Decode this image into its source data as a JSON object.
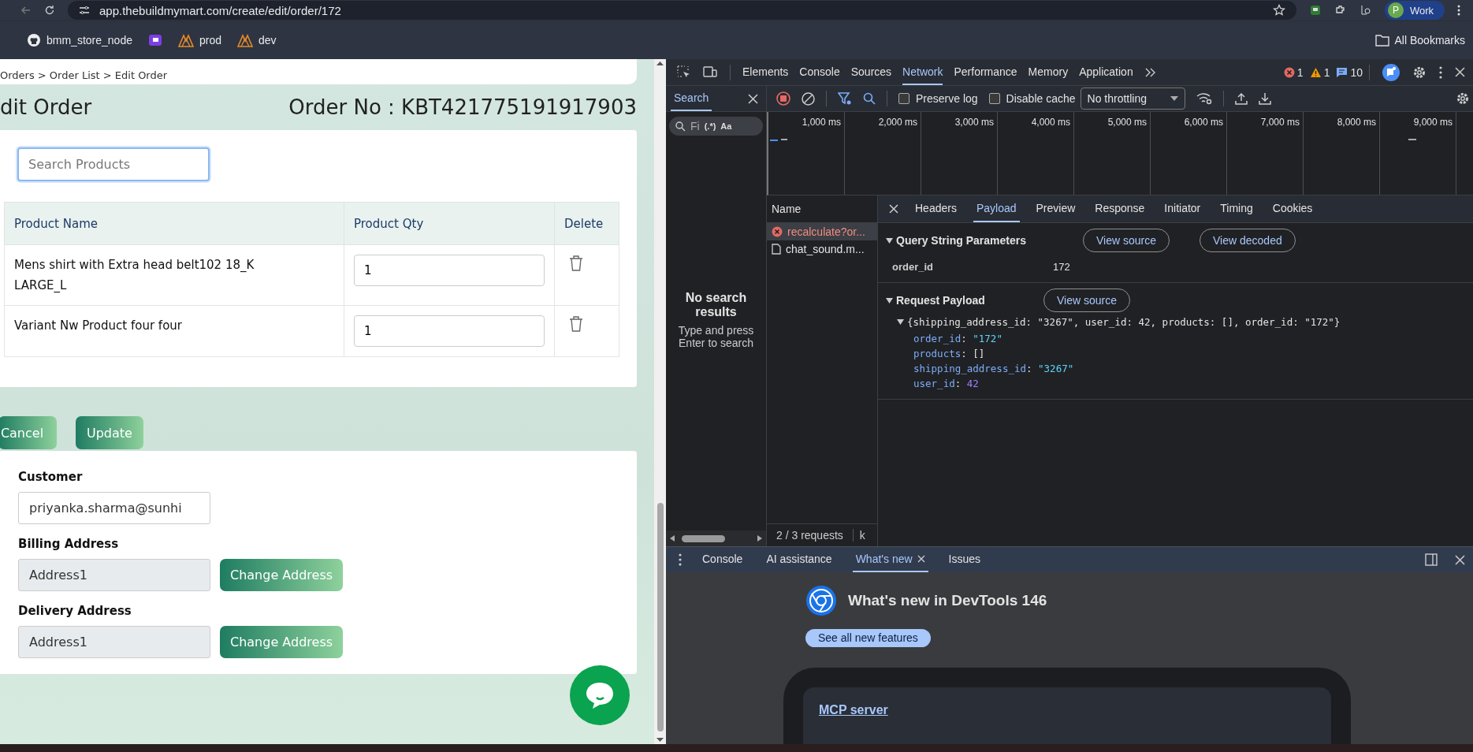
{
  "browser": {
    "url": "app.thebuildmymart.com/create/edit/order/172",
    "profile": {
      "initial": "P",
      "label": "Work"
    },
    "bookmarks": [
      {
        "kind": "github",
        "label": "bmm_store_node"
      },
      {
        "kind": "app"
      },
      {
        "kind": "logo",
        "label": "prod"
      },
      {
        "kind": "logo",
        "label": "dev"
      }
    ],
    "all_bookmarks": "All Bookmarks"
  },
  "page": {
    "breadcrumb": "Orders > Order List > Edit Order",
    "title": "dit Order",
    "order_no": "Order No : KBT421775191917903",
    "search": {
      "placeholder": "Search Products"
    },
    "columns": [
      "Product Name",
      "Product Qty",
      "Delete"
    ],
    "rows": [
      {
        "name": "Mens shirt with Extra head belt102 18_K LARGE_L",
        "qty": "1"
      },
      {
        "name": "Variant Nw Product four four",
        "qty": "1"
      }
    ],
    "buttons": [
      "Cancel",
      "Update"
    ],
    "customer": {
      "label": "Customer",
      "value": "priyanka.sharma@sunhi"
    },
    "addresses": [
      {
        "label": "Billing Address",
        "value": "Address1",
        "button": "Change Address"
      },
      {
        "label": "Delivery Address",
        "value": "Address1",
        "button": "Change Address"
      }
    ]
  },
  "devtools": {
    "tabs": [
      {
        "label": "Elements",
        "selected": false
      },
      {
        "label": "Console",
        "selected": false
      },
      {
        "label": "Sources",
        "selected": false
      },
      {
        "label": "Network",
        "selected": true
      },
      {
        "label": "Performance",
        "selected": false
      },
      {
        "label": "Memory",
        "selected": false
      },
      {
        "label": "Application",
        "selected": false
      }
    ],
    "counts": {
      "errors": "1",
      "warnings": "1",
      "messages": "10"
    },
    "search_pane": {
      "tab": "Search",
      "placeholder": "Fi",
      "regex": "(.*)",
      "case": "Aa",
      "empty_title": "No search results",
      "empty_hint": "Type and press Enter to search"
    },
    "toolbar": {
      "preserve_log": {
        "label": "Preserve log",
        "checked": false
      },
      "disable_cache": {
        "label": "Disable cache",
        "checked": false
      },
      "throttling": "No throttling"
    },
    "timeline_ticks": [
      "1,000 ms",
      "2,000 ms",
      "3,000 ms",
      "4,000 ms",
      "5,000 ms",
      "6,000 ms",
      "7,000 ms",
      "8,000 ms",
      "9,000 ms"
    ],
    "requests": {
      "header": "Name",
      "items": [
        {
          "name": "recalculate?or...",
          "error": true,
          "selected": true
        },
        {
          "name": "chat_sound.m...",
          "error": false,
          "selected": false
        }
      ],
      "summary": "2 / 3 requests",
      "footer_cut": "k"
    },
    "detail_tabs": [
      {
        "label": "Headers",
        "selected": false
      },
      {
        "label": "Payload",
        "selected": true
      },
      {
        "label": "Preview",
        "selected": false
      },
      {
        "label": "Response",
        "selected": false
      },
      {
        "label": "Initiator",
        "selected": false
      },
      {
        "label": "Timing",
        "selected": false
      },
      {
        "label": "Cookies",
        "selected": false
      }
    ],
    "query": {
      "title": "Query String Parameters",
      "expanded": true,
      "buttons": [
        "View source",
        "View decoded"
      ],
      "params": [
        {
          "key": "order_id",
          "value": "172"
        }
      ]
    },
    "payload": {
      "title": "Request Payload",
      "expanded": true,
      "buttons": [
        "View source"
      ],
      "summary": "{shipping_address_id: \"3267\", user_id: 42, products: [], order_id: \"172\"}",
      "fields": [
        {
          "key": "order_id",
          "sep": ":",
          "value": "\"172\"",
          "kind": "string"
        },
        {
          "key": "products",
          "sep": ":",
          "value": "[]",
          "kind": "array"
        },
        {
          "key": "shipping_address_id",
          "sep": ":",
          "value": "\"3267\"",
          "kind": "string"
        },
        {
          "key": "user_id",
          "sep": ":",
          "value": "42",
          "kind": "number"
        }
      ]
    },
    "drawer_tabs": [
      {
        "label": "Console",
        "selected": false
      },
      {
        "label": "AI assistance",
        "selected": false
      },
      {
        "label": "What's new",
        "selected": true
      },
      {
        "label": "Issues",
        "selected": false
      }
    ],
    "whats_new": {
      "title": "What's new in DevTools 146",
      "button": "See all new features",
      "card_link": "MCP server"
    }
  }
}
